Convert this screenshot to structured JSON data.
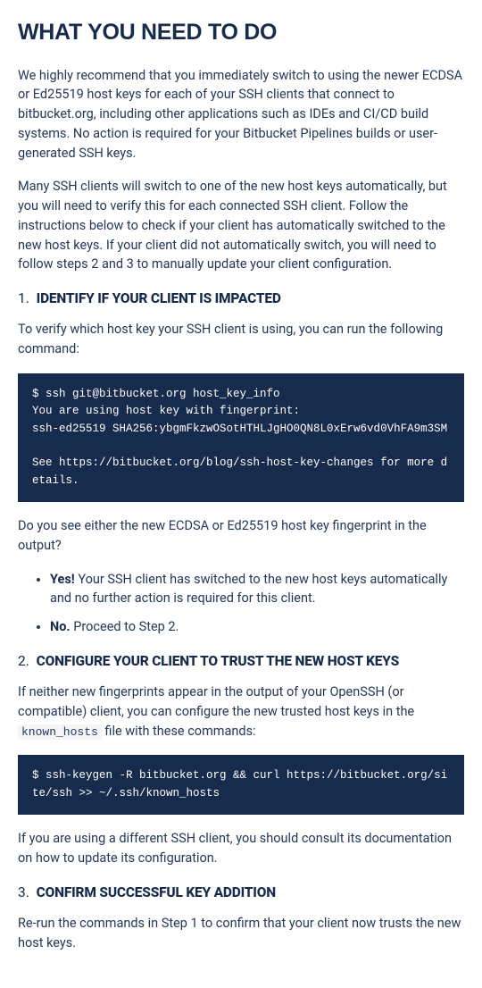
{
  "title": "WHAT YOU NEED TO DO",
  "intro1": "We highly recommend that you immediately switch to using the newer ECDSA or Ed25519 host keys for each of your SSH clients that connect to bitbucket.org, including other applications such as IDEs and CI/CD build systems. No action is required for your Bitbucket Pipelines builds or user-generated SSH keys.",
  "intro2": "Many SSH clients will switch to one of the new host keys automatically, but you will need to verify this for each connected SSH client. Follow the instructions below to check if your client has automatically switched to the new host keys. If your client did not automatically switch, you will need to follow steps 2 and 3 to manually update your client configuration.",
  "step1": {
    "num": "1.",
    "title": "IDENTIFY IF YOUR CLIENT IS IMPACTED",
    "lead": "To verify which host key your SSH client is using, you can run the following command:",
    "code": "$ ssh git@bitbucket.org host_key_info\nYou are using host key with fingerprint:\nssh-ed25519 SHA256:ybgmFkzwOSotHTHLJgHO0QN8L0xErw6vd0VhFA9m3SM\n\nSee https://bitbucket.org/blog/ssh-host-key-changes for more details.",
    "question": "Do you see either the new ECDSA or Ed25519 host key fingerprint in the output?",
    "yes_label": "Yes!",
    "yes_text": " Your SSH client has switched to the new host keys automatically and no further action is required for this client.",
    "no_label": "No.",
    "no_text": " Proceed to Step 2."
  },
  "step2": {
    "num": "2.",
    "title": "CONFIGURE YOUR CLIENT TO TRUST THE NEW HOST KEYS",
    "lead_a": "If neither new fingerprints appear in the output of your OpenSSH (or compatible) client, you can configure the new trusted host keys in the ",
    "lead_code": "known_hosts",
    "lead_b": " file with these commands:",
    "code": "$ ssh-keygen -R bitbucket.org && curl https://bitbucket.org/site/ssh >> ~/.ssh/known_hosts",
    "after": "If you are using a different SSH client, you should consult its documentation on how to update its configuration."
  },
  "step3": {
    "num": "3.",
    "title": "CONFIRM SUCCESSFUL KEY ADDITION",
    "lead": "Re-run the commands in Step 1 to confirm that your client now trusts the new host keys."
  }
}
